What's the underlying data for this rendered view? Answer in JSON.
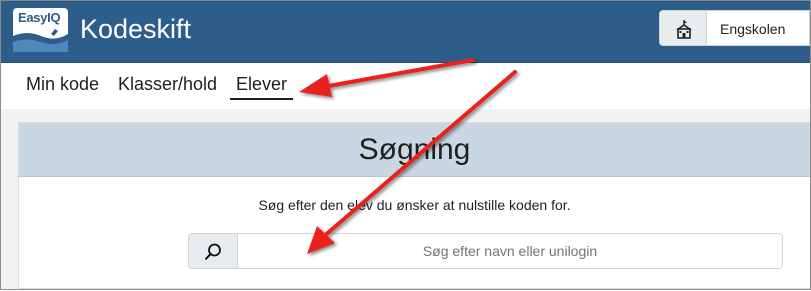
{
  "header": {
    "logo_text": "EasyIQ",
    "app_title": "Kodeskift",
    "school_icon": "school-building-icon",
    "school_name": "Engskolen"
  },
  "nav": {
    "tabs": [
      {
        "label": "Min kode",
        "active": false
      },
      {
        "label": "Klasser/hold",
        "active": false
      },
      {
        "label": "Elever",
        "active": true
      }
    ]
  },
  "search": {
    "title": "Søgning",
    "instruction": "Søg efter den elev du ønsker at nulstille koden for.",
    "icon": "search-icon",
    "placeholder": "Søg efter navn eller unilogin",
    "value": ""
  },
  "colors": {
    "header_bg": "#2d5d8b",
    "card_header_bg": "#c9d7e4",
    "annotation_arrow": "#e8201e"
  }
}
